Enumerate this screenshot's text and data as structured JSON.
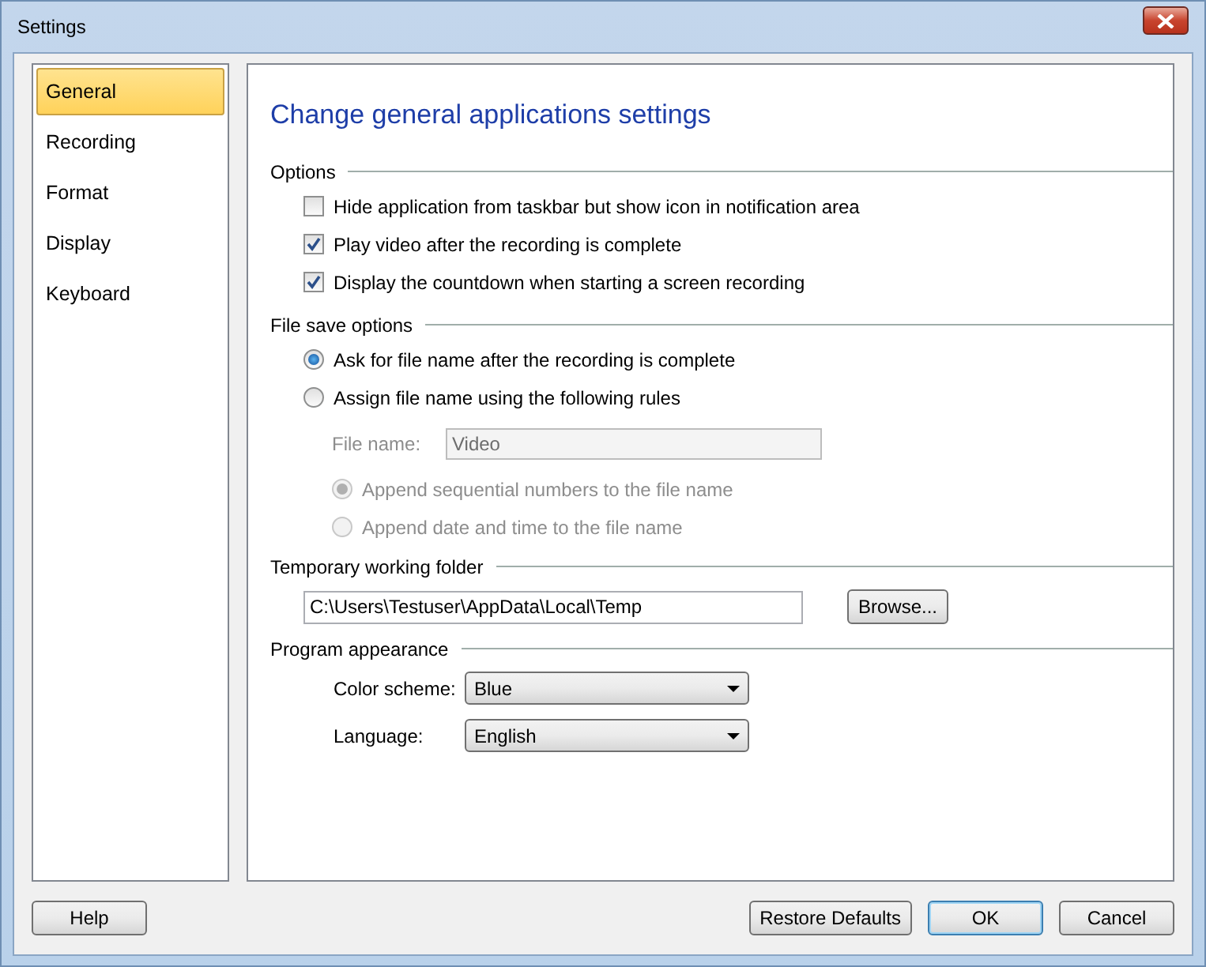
{
  "window": {
    "title": "Settings"
  },
  "sidebar": {
    "items": [
      {
        "label": "General",
        "selected": true
      },
      {
        "label": "Recording",
        "selected": false
      },
      {
        "label": "Format",
        "selected": false
      },
      {
        "label": "Display",
        "selected": false
      },
      {
        "label": "Keyboard",
        "selected": false
      }
    ]
  },
  "page": {
    "heading": "Change general applications settings",
    "sections": [
      {
        "title": "Options",
        "items": [
          {
            "kind": "checkbox",
            "label": "Hide application from taskbar but show icon in notification area",
            "checked": false
          },
          {
            "kind": "checkbox",
            "label": "Play video after the recording is complete",
            "checked": true
          },
          {
            "kind": "checkbox",
            "label": "Display the countdown when starting a screen recording",
            "checked": true
          }
        ]
      },
      {
        "title": "File save options",
        "items": [
          {
            "kind": "radio",
            "label": "Ask for file name after the recording is complete",
            "selected": true,
            "disabled": false
          },
          {
            "kind": "radio",
            "label": "Assign file name using the following rules",
            "selected": false,
            "disabled": false,
            "children": [
              {
                "kind": "textfield",
                "label": "File name:",
                "value": "Video",
                "disabled": true
              },
              {
                "kind": "radio",
                "label": "Append sequential numbers to the file name",
                "selected": true,
                "disabled": true
              },
              {
                "kind": "radio",
                "label": "Append date and time to the file name",
                "selected": false,
                "disabled": true
              }
            ]
          }
        ]
      },
      {
        "title": "Temporary working folder",
        "items": [
          {
            "kind": "path",
            "value": "C:\\Users\\Testuser\\AppData\\Local\\Temp",
            "button": "Browse..."
          }
        ]
      },
      {
        "title": "Program appearance",
        "items": [
          {
            "kind": "dropdown",
            "label": "Color scheme:",
            "value": "Blue"
          },
          {
            "kind": "dropdown",
            "label": "Language:",
            "value": "English"
          }
        ]
      }
    ]
  },
  "buttons": [
    {
      "label": "Help",
      "default": false
    },
    {
      "label": "Restore Defaults",
      "default": false
    },
    {
      "label": "OK",
      "default": true
    },
    {
      "label": "Cancel",
      "default": false
    }
  ]
}
